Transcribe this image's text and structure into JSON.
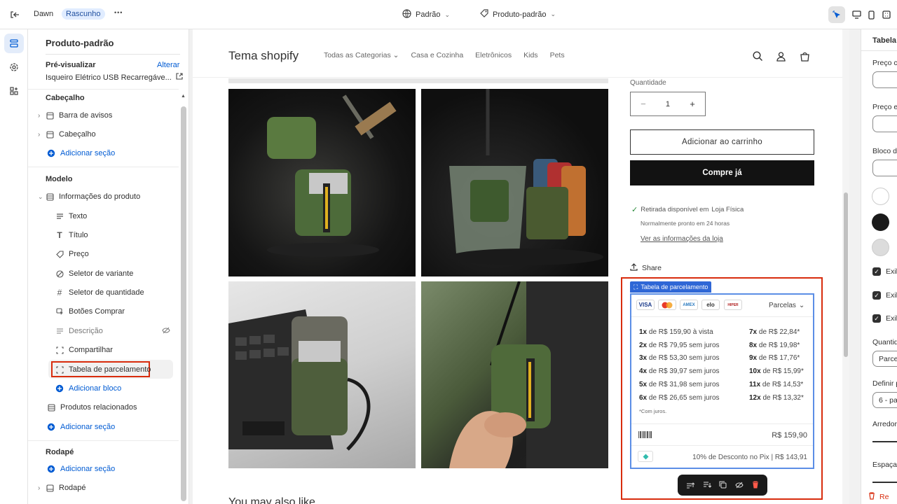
{
  "topbar": {
    "theme_name": "Dawn",
    "draft_badge": "Rascunho",
    "more_label": "•••",
    "preset_label": "Padrão",
    "template_label": "Produto-padrão"
  },
  "sidebar": {
    "header_title": "Produto-padrão",
    "preview_label": "Pré-visualizar",
    "preview_change": "Alterar",
    "preview_product": "Isqueiro Elétrico USB Recarregáve...",
    "sections": {
      "header_group": "Cabeçalho",
      "announcement_bar": "Barra de avisos",
      "header": "Cabeçalho",
      "add_section_1": "Adicionar seção",
      "template_group": "Modelo",
      "product_info": "Informações do produto",
      "blocks": [
        "Texto",
        "Título",
        "Preço",
        "Seletor de variante",
        "Seletor de quantidade",
        "Botões Comprar",
        "Descrição",
        "Compartilhar",
        "Tabela de parcelamento"
      ],
      "add_block": "Adicionar bloco",
      "related_products": "Produtos relacionados",
      "add_section_2": "Adicionar seção",
      "footer_group": "Rodapé",
      "add_section_3": "Adicionar seção",
      "footer": "Rodapé"
    }
  },
  "store": {
    "name": "Tema shopify",
    "nav": [
      "Todas as Categorias",
      "Casa e Cozinha",
      "Eletrônicos",
      "Kids",
      "Pets"
    ],
    "quantity_label": "Quantidade",
    "quantity_value": "1",
    "minus": "−",
    "plus": "+",
    "add_to_cart": "Adicionar ao carrinho",
    "buy_now": "Compre já",
    "pickup_prefix": "Retirada disponível em",
    "pickup_location": "Loja Física",
    "pickup_time": "Normalmente pronto em 24 horas",
    "store_info_link": "Ver as informações da loja",
    "share": "Share",
    "you_may_like": "You may also like"
  },
  "installments": {
    "block_tag": "Tabela de parcelamento",
    "cards": [
      "VISA",
      "MC",
      "AMEX",
      "elo",
      "HIPER"
    ],
    "dropdown": "Parcelas",
    "left": [
      {
        "n": "1x",
        "text": " de R$ 159,90 à vista"
      },
      {
        "n": "2x",
        "text": " de R$ 79,95 sem juros"
      },
      {
        "n": "3x",
        "text": " de R$ 53,30 sem juros"
      },
      {
        "n": "4x",
        "text": " de R$ 39,97 sem juros"
      },
      {
        "n": "5x",
        "text": " de R$ 31,98 sem juros"
      },
      {
        "n": "6x",
        "text": " de R$ 26,65 sem juros"
      }
    ],
    "right": [
      {
        "n": "7x",
        "text": " de R$ 22,84*"
      },
      {
        "n": "8x",
        "text": " de R$ 19,98*"
      },
      {
        "n": "9x",
        "text": " de R$ 17,76*"
      },
      {
        "n": "10x",
        "text": " de R$ 15,99*"
      },
      {
        "n": "11x",
        "text": " de R$ 14,53*"
      },
      {
        "n": "12x",
        "text": " de R$ 13,32*"
      }
    ],
    "footnote": "*Com juros.",
    "boleto_price": "R$ 159,90",
    "pix_text": "10% de Desconto no Pix | R$ 143,91"
  },
  "right_panel": {
    "title": "Tabela",
    "labels": [
      "Preço c",
      "Preço e",
      "Bloco d"
    ],
    "checks": [
      "Exib",
      "Exib",
      "Exib"
    ],
    "qty_label": "Quantid",
    "qty_select": "Parce",
    "define_label": "Definir p",
    "define_select": "6 - pa",
    "round_label": "Arredor",
    "spacing_label": "Espaçar",
    "remove_label": "Re"
  },
  "colors": {
    "accent": "#005bd3",
    "highlight_red": "#d82c0d",
    "draft_bg": "#e0ecff"
  }
}
